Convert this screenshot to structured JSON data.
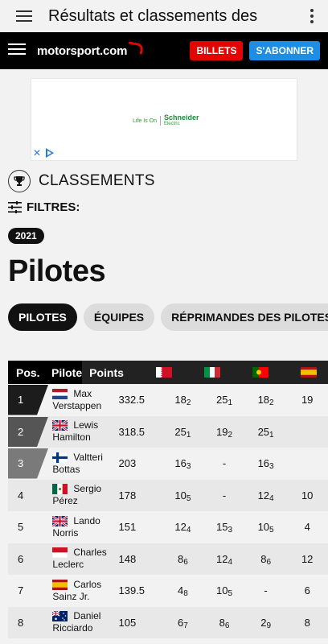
{
  "appbar": {
    "title": "Résultats et classements des"
  },
  "navbar": {
    "logo_text": "motorsport.com",
    "billets_label": "BILLETS",
    "abonner_label": "S'ABONNER"
  },
  "ad": {
    "tagline": "Life Is On",
    "brand": "Schneider",
    "brand_sub": "Electric"
  },
  "section": {
    "classements_label": "CLASSEMENTS",
    "filtres_label": "FILTRES:",
    "year": "2021",
    "page_title": "Pilotes"
  },
  "tabs": [
    {
      "label": "PILOTES",
      "active": true
    },
    {
      "label": "ÉQUIPES",
      "active": false
    },
    {
      "label": "RÉPRIMANDES DES PILOTES",
      "active": false
    }
  ],
  "table": {
    "headers": {
      "pos": "Pos.",
      "pilote": "Pilote",
      "points": "Points"
    },
    "race_flags": [
      "flag-bahrain-icon",
      "flag-italy-icon",
      "flag-portugal-icon",
      "flag-spain-icon"
    ],
    "rows": [
      {
        "pos": "1",
        "flag": "flag-netherlands-icon",
        "first": "Max",
        "last": "Verstappen",
        "points": "332.5",
        "results": [
          [
            "18",
            "2"
          ],
          [
            "25",
            "1"
          ],
          [
            "18",
            "2"
          ],
          [
            "19",
            ""
          ]
        ]
      },
      {
        "pos": "2",
        "flag": "flag-uk-icon",
        "first": "Lewis",
        "last": "Hamilton",
        "points": "318.5",
        "results": [
          [
            "25",
            "1"
          ],
          [
            "19",
            "2"
          ],
          [
            "25",
            "1"
          ],
          [
            "",
            ""
          ]
        ]
      },
      {
        "pos": "3",
        "flag": "flag-finland-icon",
        "first": "Valtteri",
        "last": "Bottas",
        "points": "203",
        "results": [
          [
            "16",
            "3"
          ],
          [
            "-",
            ""
          ],
          [
            "16",
            "3"
          ],
          [
            "",
            ""
          ]
        ]
      },
      {
        "pos": "4",
        "flag": "flag-mexico-icon",
        "first": "Sergio",
        "last": "Pérez",
        "points": "178",
        "results": [
          [
            "10",
            "5"
          ],
          [
            "-",
            ""
          ],
          [
            "12",
            "4"
          ],
          [
            "10",
            ""
          ]
        ]
      },
      {
        "pos": "5",
        "flag": "flag-uk-icon",
        "first": "Lando",
        "last": "Norris",
        "points": "151",
        "results": [
          [
            "12",
            "4"
          ],
          [
            "15",
            "3"
          ],
          [
            "10",
            "5"
          ],
          [
            "4",
            ""
          ]
        ]
      },
      {
        "pos": "6",
        "flag": "flag-monaco-icon",
        "first": "Charles",
        "last": "Leclerc",
        "points": "148",
        "results": [
          [
            "8",
            "6"
          ],
          [
            "12",
            "4"
          ],
          [
            "8",
            "6"
          ],
          [
            "12",
            ""
          ]
        ]
      },
      {
        "pos": "7",
        "flag": "flag-spain-icon",
        "first": "Carlos",
        "last": "Sainz Jr.",
        "points": "139.5",
        "results": [
          [
            "4",
            "8"
          ],
          [
            "10",
            "5"
          ],
          [
            "-",
            ""
          ],
          [
            "6",
            ""
          ]
        ]
      },
      {
        "pos": "8",
        "flag": "flag-australia-icon",
        "first": "Daniel",
        "last": "Ricciardo",
        "points": "105",
        "results": [
          [
            "6",
            "7"
          ],
          [
            "8",
            "6"
          ],
          [
            "2",
            "9"
          ],
          [
            "8",
            ""
          ]
        ]
      }
    ]
  }
}
